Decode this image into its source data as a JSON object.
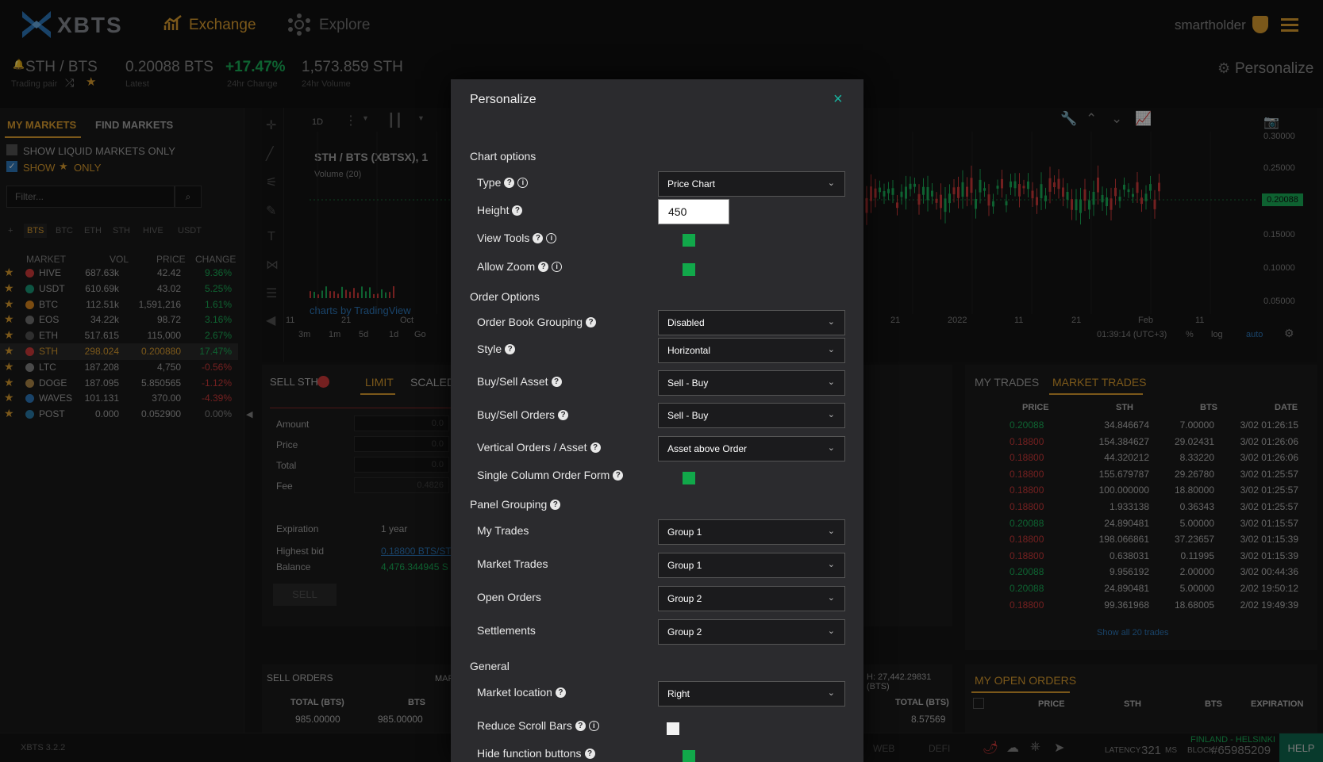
{
  "header": {
    "logo": "XBTS",
    "nav_exchange": "Exchange",
    "nav_explore": "Explore",
    "user": "smartholder"
  },
  "ticker": {
    "pair": "STH / BTS",
    "pair_label": "Trading pair",
    "latest": "0.20088 BTS",
    "latest_label": "Latest",
    "change": "+17.47%",
    "change_label": "24hr Change",
    "volume": "1,573.859 STH",
    "volume_label": "24hr Volume",
    "personalize": "Personalize"
  },
  "markets": {
    "tab_my": "MY MARKETS",
    "tab_find": "FIND MARKETS",
    "liquid_only": "SHOW LIQUID MARKETS ONLY",
    "show": "SHOW",
    "only": "ONLY",
    "filter_placeholder": "Filter...",
    "bases": [
      "+",
      "BTS",
      "BTC",
      "ETH",
      "STH",
      "HIVE",
      "USDT"
    ],
    "cols": [
      "MARKET",
      "VOL",
      "PRICE",
      "CHANGE"
    ],
    "rows": [
      {
        "name": "HIVE",
        "vol": "687.63k",
        "price": "42.42",
        "change": "9.36%",
        "up": true
      },
      {
        "name": "USDT",
        "vol": "610.69k",
        "price": "43.02",
        "change": "5.25%",
        "up": true
      },
      {
        "name": "BTC",
        "vol": "112.51k",
        "price": "1,591,216",
        "change": "1.61%",
        "up": true
      },
      {
        "name": "EOS",
        "vol": "34.22k",
        "price": "98.72",
        "change": "3.16%",
        "up": true
      },
      {
        "name": "ETH",
        "vol": "517.615",
        "price": "115,000",
        "change": "2.67%",
        "up": true
      },
      {
        "name": "STH",
        "vol": "298.024",
        "price": "0.200880",
        "change": "17.47%",
        "up": true,
        "active": true
      },
      {
        "name": "LTC",
        "vol": "187.208",
        "price": "4,750",
        "change": "-0.56%",
        "up": false
      },
      {
        "name": "DOGE",
        "vol": "187.095",
        "price": "5.850565",
        "change": "-1.12%",
        "up": false
      },
      {
        "name": "WAVES",
        "vol": "101.131",
        "price": "370.00",
        "change": "-4.39%",
        "up": false
      },
      {
        "name": "POST",
        "vol": "0.000",
        "price": "0.052900",
        "change": "0.00%",
        "up": null
      }
    ]
  },
  "chart": {
    "interval": "1D",
    "title": "STH / BTS (XBTSX), 1",
    "volume": "Volume (20)",
    "watermark": "charts by TradingView",
    "y_ticks": [
      "0.30000",
      "0.25000",
      "0.15000",
      "0.10000",
      "0.05000"
    ],
    "price_tag": "0.20088",
    "x_ticks_left": [
      "11",
      "21",
      "Oct"
    ],
    "x_ticks_right": [
      "11",
      "21",
      "2022",
      "11",
      "21",
      "Feb",
      "11"
    ],
    "ranges": [
      "3m",
      "1m",
      "5d",
      "1d",
      "Go"
    ],
    "time": "01:39:14 (UTC+3)",
    "pct": "%",
    "log": "log",
    "auto": "auto"
  },
  "order_form": {
    "sell_label": "SELL STH",
    "tab_limit": "LIMIT",
    "tab_scaled": "SCALED",
    "amount": "Amount",
    "price": "Price",
    "total": "Total",
    "fee": "Fee",
    "amount_val": "0.0",
    "price_val": "0.0",
    "total_val": "0.0",
    "fee_val": "0.4826",
    "expiration": "Expiration",
    "expiration_val": "1 year",
    "highest_bid": "Highest bid",
    "highest_bid_val": "0.18800 BTS/ST",
    "balance": "Balance",
    "balance_val": "4,476.344945 S",
    "sell_button": "SELL"
  },
  "sell_orders": {
    "title": "SELL ORDERS",
    "mar": "MAR",
    "cols": [
      "TOTAL (BTS)",
      "BTS"
    ],
    "row": [
      "985.00000",
      "985.00000"
    ],
    "right_total": "H: 27,442.29831 (BTS)",
    "right_col": "TOTAL (BTS)",
    "right_val": "8.57569"
  },
  "trades": {
    "tab_my": "MY TRADES",
    "tab_market": "MARKET TRADES",
    "cols": [
      "PRICE",
      "STH",
      "BTS",
      "DATE"
    ],
    "rows": [
      {
        "price": "0.20088",
        "sth": "34.846674",
        "bts": "7.00000",
        "date": "3/02 01:26:15",
        "buy": true
      },
      {
        "price": "0.18800",
        "sth": "154.384627",
        "bts": "29.02431",
        "date": "3/02 01:26:06",
        "buy": false
      },
      {
        "price": "0.18800",
        "sth": "44.320212",
        "bts": "8.33220",
        "date": "3/02 01:26:06",
        "buy": false
      },
      {
        "price": "0.18800",
        "sth": "155.679787",
        "bts": "29.26780",
        "date": "3/02 01:25:57",
        "buy": false
      },
      {
        "price": "0.18800",
        "sth": "100.000000",
        "bts": "18.80000",
        "date": "3/02 01:25:57",
        "buy": false
      },
      {
        "price": "0.18800",
        "sth": "1.933138",
        "bts": "0.36343",
        "date": "3/02 01:25:57",
        "buy": false
      },
      {
        "price": "0.20088",
        "sth": "24.890481",
        "bts": "5.00000",
        "date": "3/02 01:15:57",
        "buy": true
      },
      {
        "price": "0.18800",
        "sth": "198.066861",
        "bts": "37.23657",
        "date": "3/02 01:15:39",
        "buy": false
      },
      {
        "price": "0.18800",
        "sth": "0.638031",
        "bts": "0.11995",
        "date": "3/02 01:15:39",
        "buy": false
      },
      {
        "price": "0.20088",
        "sth": "9.956192",
        "bts": "2.00000",
        "date": "3/02 00:44:36",
        "buy": true
      },
      {
        "price": "0.20088",
        "sth": "24.890481",
        "bts": "5.00000",
        "date": "2/02 19:50:12",
        "buy": true
      },
      {
        "price": "0.18800",
        "sth": "99.361968",
        "bts": "18.68005",
        "date": "2/02 19:49:39",
        "buy": false
      }
    ],
    "show_all": "Show all 20 trades"
  },
  "open_orders": {
    "title": "MY OPEN ORDERS",
    "cols": [
      "PRICE",
      "STH",
      "BTS",
      "EXPIRATION"
    ]
  },
  "footer": {
    "version": "XBTS 3.2.2",
    "web": "WEB",
    "defi": "DEFI",
    "location": "FINLAND - HELSINKI",
    "latency_label": "LATENCY",
    "latency": "321",
    "ms": "MS",
    "block_label": "BLOCK",
    "block": "#65985209",
    "help": "HELP"
  },
  "modal": {
    "title": "Personalize",
    "chart_options": "Chart options",
    "type": "Type",
    "type_val": "Price Chart",
    "height": "Height",
    "height_val": "450",
    "view_tools": "View Tools",
    "allow_zoom": "Allow Zoom",
    "order_options": "Order Options",
    "order_book_grouping": "Order Book Grouping",
    "order_book_grouping_val": "Disabled",
    "style": "Style",
    "style_val": "Horizontal",
    "buy_sell_asset": "Buy/Sell Asset",
    "buy_sell_asset_val": "Sell - Buy",
    "buy_sell_orders": "Buy/Sell Orders",
    "buy_sell_orders_val": "Sell - Buy",
    "vertical_orders": "Vertical Orders / Asset",
    "vertical_orders_val": "Asset above Order",
    "single_column": "Single Column Order Form",
    "panel_grouping": "Panel Grouping",
    "my_trades": "My Trades",
    "my_trades_val": "Group 1",
    "market_trades": "Market Trades",
    "market_trades_val": "Group 1",
    "open_orders": "Open Orders",
    "open_orders_val": "Group 2",
    "settlements": "Settlements",
    "settlements_val": "Group 2",
    "general": "General",
    "market_location": "Market location",
    "market_location_val": "Right",
    "reduce_scroll": "Reduce Scroll Bars",
    "hide_function": "Hide function buttons"
  },
  "colors": {
    "accent": "#e0a030",
    "up": "#1bb35a",
    "down": "#d33b3b",
    "checked": "#11a84a"
  }
}
